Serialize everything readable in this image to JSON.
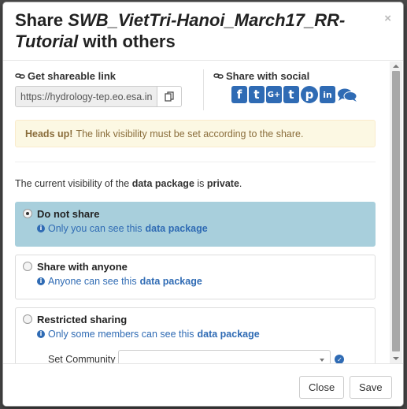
{
  "modal": {
    "title_prefix": "Share",
    "package_name": "SWB_VietTri-Hanoi_March17_RR-Tutorial",
    "title_suffix": "with others",
    "close_symbol": "×"
  },
  "share_link": {
    "label": "Get shareable link",
    "url_value": "https://hydrology-tep.eo.esa.int"
  },
  "social": {
    "label": "Share with social",
    "icons": [
      "facebook-icon",
      "twitter-icon",
      "google-plus-icon",
      "tumblr-icon",
      "pinterest-icon",
      "linkedin-icon",
      "comments-icon"
    ],
    "icon_glyphs": [
      "f",
      "t",
      "G+",
      "t",
      "p",
      "in",
      "💬"
    ]
  },
  "alert": {
    "strong": "Heads up!",
    "text": "The link visibility must be set according to the share."
  },
  "visibility": {
    "prefix": "The current visibility of the",
    "object": "data package",
    "middle": "is",
    "state": "private",
    "suffix": "."
  },
  "options": [
    {
      "title": "Do not share",
      "desc": "Only you can see this",
      "pkg": "data package",
      "selected": true
    },
    {
      "title": "Share with anyone",
      "desc": "Anyone can see this",
      "pkg": "data package",
      "selected": false
    },
    {
      "title": "Restricted sharing",
      "desc": "Only some members can see this",
      "pkg": "data package",
      "selected": false
    }
  ],
  "community": {
    "label": "Set Community",
    "value": ""
  },
  "footer": {
    "close_label": "Close",
    "save_label": "Save"
  },
  "colors": {
    "accent": "#2f6bb4",
    "selected_bg": "#a8cfdc",
    "alert_bg": "#fcf8e3",
    "alert_text": "#8a6d3b"
  }
}
